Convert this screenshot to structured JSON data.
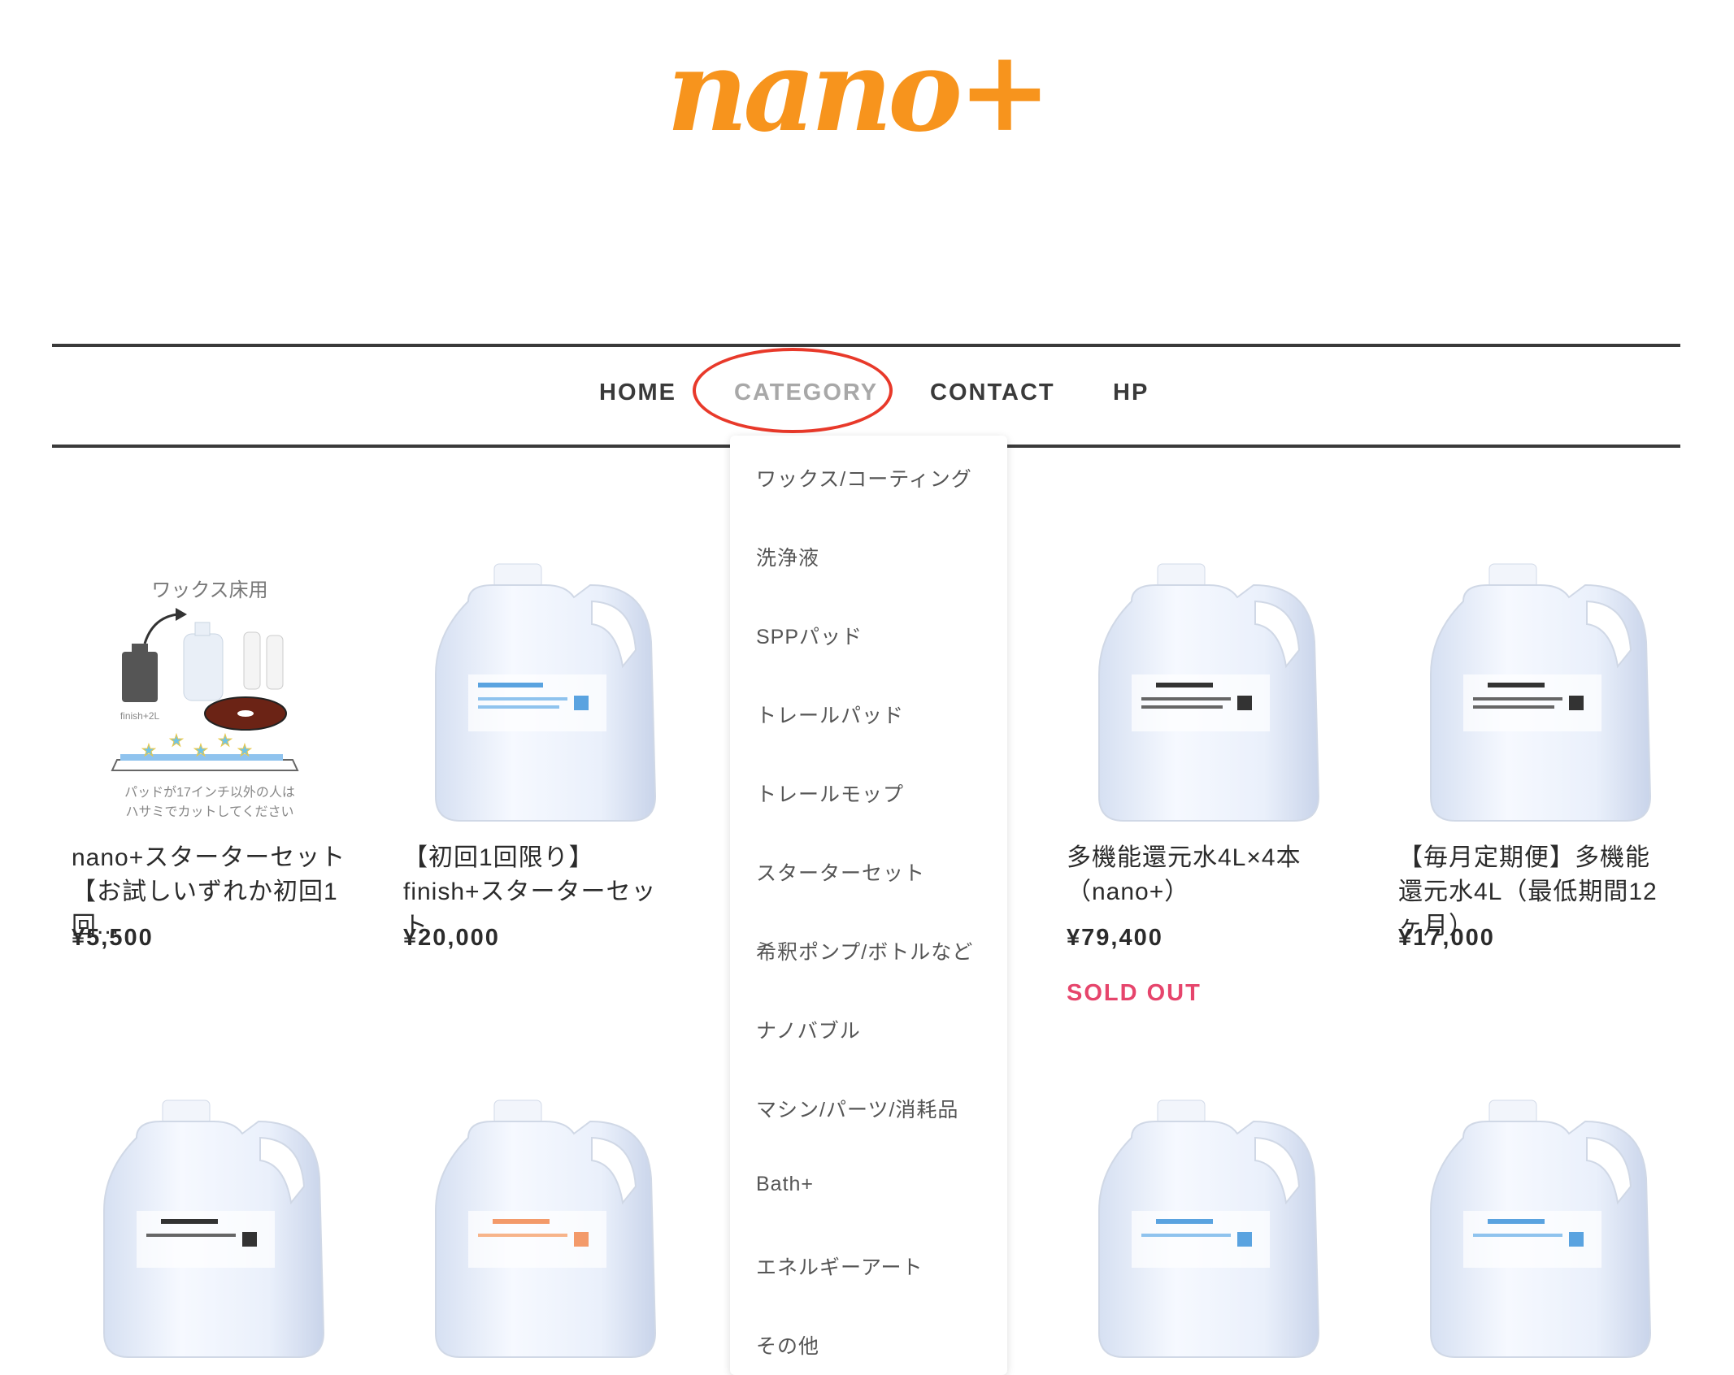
{
  "brand": {
    "logo_text": "nano+",
    "logo_color": "#f7941d"
  },
  "nav": {
    "items": [
      {
        "label": "HOME"
      },
      {
        "label": "CATEGORY"
      },
      {
        "label": "CONTACT"
      },
      {
        "label": "HP"
      }
    ],
    "highlight_color": "#e8392a"
  },
  "category_menu": {
    "items": [
      "ワックス/コーティング",
      "洗浄液",
      "SPPパッド",
      "トレールパッド",
      "トレールモップ",
      "スターターセット",
      "希釈ポンプ/ボトルなど",
      "ナノバブル",
      "マシン/パーツ/消耗品",
      "Bath+",
      "エネルギーアート",
      "その他"
    ]
  },
  "products": [
    {
      "name": "nano+スターターセット【お試しいずれか初回1回...",
      "price": "¥5,500",
      "image": {
        "title": "ワックス床用",
        "bottle_label": "finish+2L",
        "caption_line1": "パッドが17インチ以外の人は",
        "caption_line2": "ハサミでカットしてください"
      }
    },
    {
      "name": "【初回1回限り】finish+スターターセット",
      "price": "¥20,000",
      "image": {
        "label_color": "#5aa3e0"
      }
    },
    {
      "name": "多機能還元水4L×4本（nano+）",
      "price": "¥79,400",
      "status": "SOLD OUT",
      "image": {
        "label_color": "#333333"
      }
    },
    {
      "name": "【毎月定期便】多機能還元水4L（最低期間12ヶ月）",
      "price": "¥17,000",
      "image": {
        "label_color": "#333333"
      }
    }
  ],
  "colors": {
    "sold_out": "#e6456c",
    "accent": "#f7941d"
  }
}
